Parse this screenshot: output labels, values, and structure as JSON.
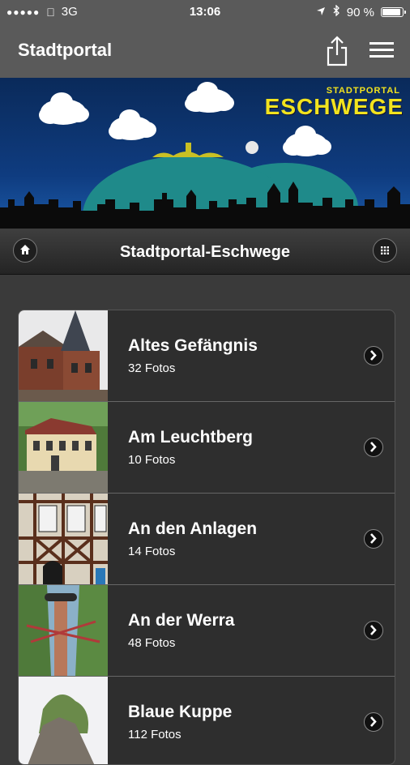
{
  "status": {
    "carrier_dots": "●●●●●",
    "network": "3G",
    "time": "13:06",
    "battery_percent": "90 %",
    "battery_level": 0.9
  },
  "app": {
    "title": "Stadtportal"
  },
  "banner": {
    "logo_small": "STADTPORTAL",
    "logo_big": "ESCHWEGE"
  },
  "nav": {
    "title": "Stadtportal-Eschwege"
  },
  "items": [
    {
      "title": "Altes Gefängnis",
      "subtitle": "32 Fotos"
    },
    {
      "title": "Am Leuchtberg",
      "subtitle": "10 Fotos"
    },
    {
      "title": "An den Anlagen",
      "subtitle": "14 Fotos"
    },
    {
      "title": "An der Werra",
      "subtitle": "48 Fotos"
    },
    {
      "title": "Blaue Kuppe",
      "subtitle": "112 Fotos"
    }
  ],
  "colors": {
    "banner_yellow": "#f2e31e",
    "banner_blue": "#0f3c80",
    "hill_teal": "#1f8a8a"
  }
}
